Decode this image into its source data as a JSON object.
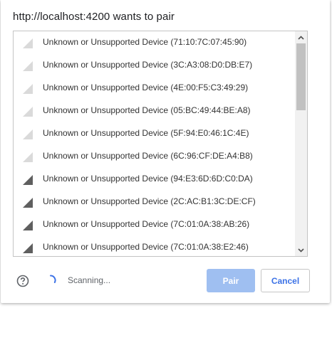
{
  "dialog": {
    "title": "http://localhost:4200 wants to pair",
    "devices": [
      {
        "label": "Unknown or Unsupported Device (71:10:7C:07:45:90)",
        "signal": 1
      },
      {
        "label": "Unknown or Unsupported Device (3C:A3:08:D0:DB:E7)",
        "signal": 1
      },
      {
        "label": "Unknown or Unsupported Device (4E:00:F5:C3:49:29)",
        "signal": 1
      },
      {
        "label": "Unknown or Unsupported Device (05:BC:49:44:BE:A8)",
        "signal": 1
      },
      {
        "label": "Unknown or Unsupported Device (5F:94:E0:46:1C:4E)",
        "signal": 1
      },
      {
        "label": "Unknown or Unsupported Device (6C:96:CF:DE:A4:B8)",
        "signal": 1
      },
      {
        "label": "Unknown or Unsupported Device (94:E3:6D:6D:C0:DA)",
        "signal": 2
      },
      {
        "label": "Unknown or Unsupported Device (2C:AC:B1:3C:DE:CF)",
        "signal": 2
      },
      {
        "label": "Unknown or Unsupported Device (7C:01:0A:38:AB:26)",
        "signal": 2
      },
      {
        "label": "Unknown or Unsupported Device (7C:01:0A:38:E2:46)",
        "signal": 2
      }
    ],
    "status": "Scanning...",
    "pair_label": "Pair",
    "cancel_label": "Cancel"
  },
  "colors": {
    "signal_weak": "#dadada",
    "signal_strong": "#5f5f5f",
    "accent": "#3c72e6",
    "pair_disabled_bg": "#9fbff1"
  },
  "icons": {
    "help": "help-circle-icon",
    "spinner": "loading-spinner-icon",
    "signal": "signal-strength-icon",
    "scroll_up": "chevron-up-icon",
    "scroll_down": "chevron-down-icon"
  }
}
